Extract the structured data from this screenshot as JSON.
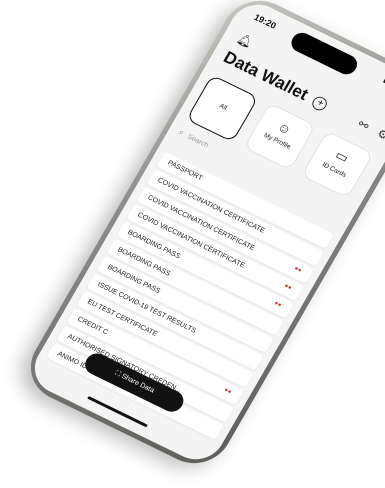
{
  "status": {
    "time": "19:20",
    "icons": "▮ ◠ ▭"
  },
  "header": {
    "title": "Data Wallet",
    "add_icon": "+",
    "link_icon": "⚯",
    "settings_icon": "⚙"
  },
  "tabs": [
    {
      "label": "All"
    },
    {
      "label": "My Profile"
    },
    {
      "label": "ID Cards"
    }
  ],
  "search": {
    "placeholder": "Search"
  },
  "documents": [
    {
      "label": "PASSPORT"
    },
    {
      "label": "COVID VACCINATION CERTIFICATE"
    },
    {
      "label": "COVID VACCINATION CERTIFICATE"
    },
    {
      "label": "COVID VACCINATION CERTIFICATE"
    },
    {
      "label": "BOARDING PASS"
    },
    {
      "label": "BOARDING PASS"
    },
    {
      "label": "BOARDING PASS"
    },
    {
      "label": "ISSUE COVID-19 TEST RESULTS"
    },
    {
      "label": "EU TEST CERTIFICATE"
    },
    {
      "label": "CREDIT C"
    },
    {
      "label": "AUTHORISED SIGNATORY CREDEN..."
    },
    {
      "label": "ANIMO ID"
    }
  ],
  "share_button": {
    "label": "Share Data"
  }
}
